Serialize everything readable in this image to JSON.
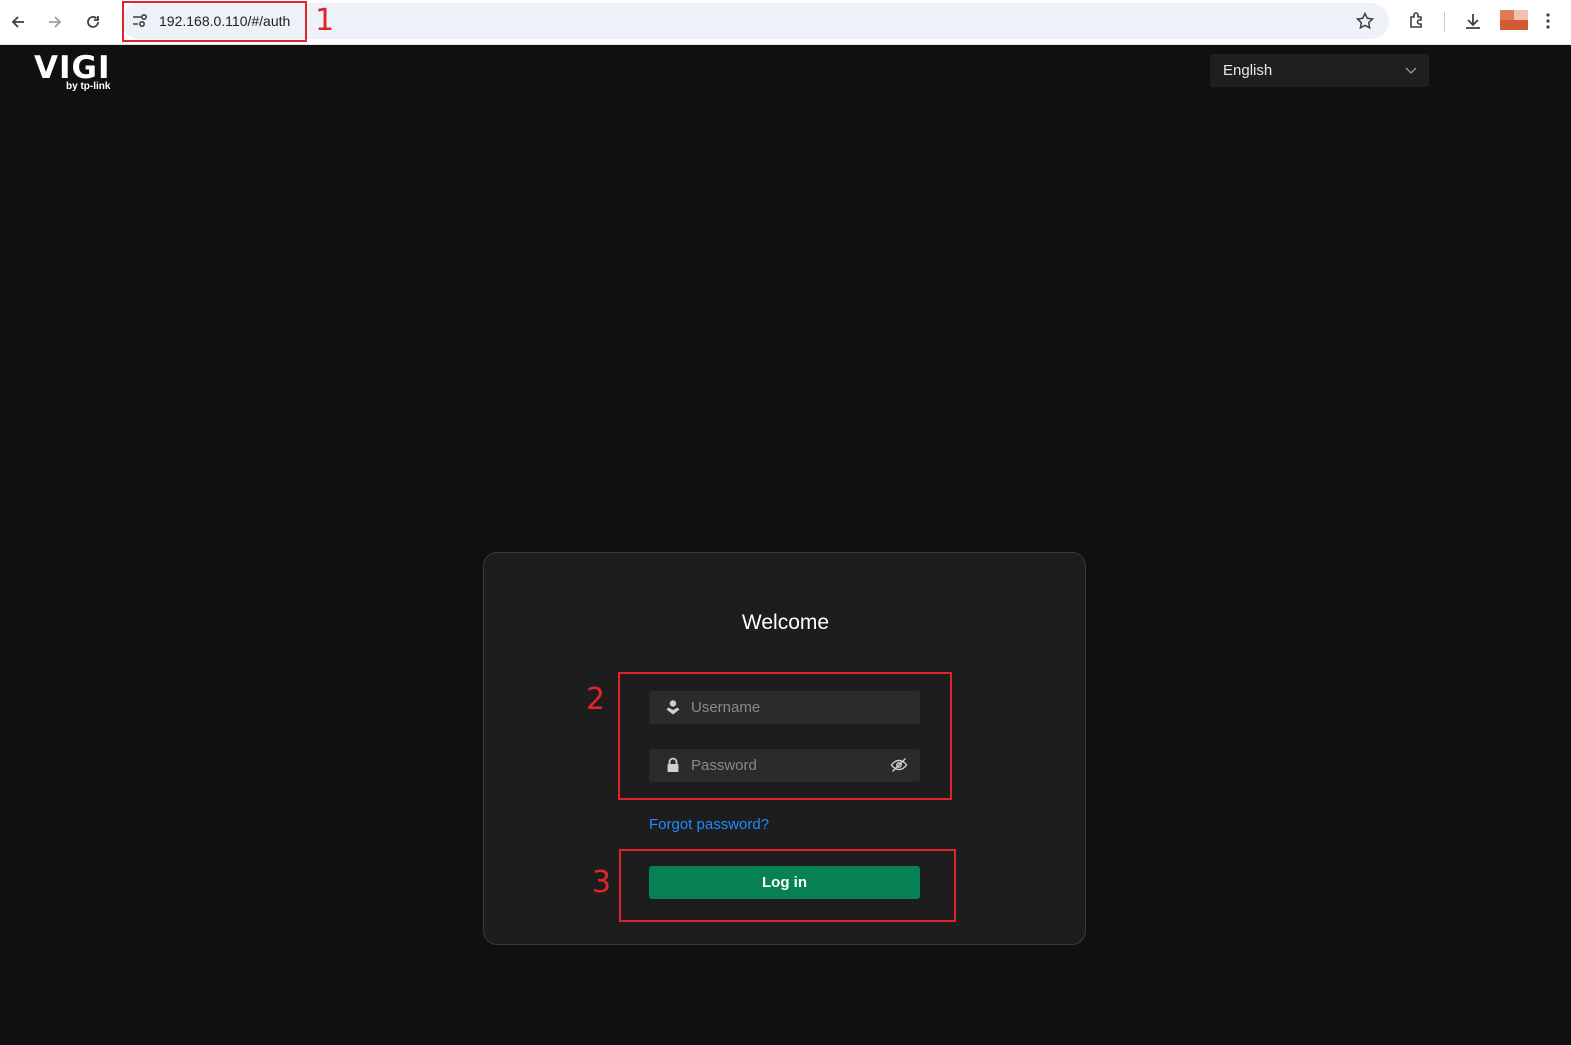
{
  "browser": {
    "url": "192.168.0.110/#/auth",
    "icons": [
      "back-arrow-icon",
      "forward-arrow-icon",
      "reload-icon",
      "site-info-icon",
      "bookmark-star-icon",
      "extensions-icon",
      "download-icon",
      "profile-avatar",
      "more-menu-icon"
    ]
  },
  "annotations": {
    "one": "1",
    "two": "2",
    "three": "3",
    "color": "#e0242c"
  },
  "header": {
    "logo_text": "VIGI",
    "logo_sub": "by tp-link",
    "language": "English"
  },
  "login": {
    "title": "Welcome",
    "username_placeholder": "Username",
    "password_placeholder": "Password",
    "forgot_label": "Forgot password?",
    "login_label": "Log in",
    "accent": "#058154",
    "link_color": "#1e8bff"
  }
}
